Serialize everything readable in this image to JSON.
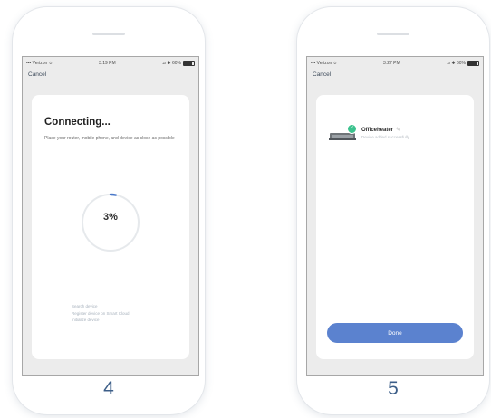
{
  "screens": [
    {
      "status": {
        "carrier": "••• Verizon ≎",
        "time": "3:19 PM",
        "battery": "⊿ ✱ 60%"
      },
      "cancel_label": "Cancel",
      "title": "Connecting...",
      "description": "Place your router, mobile phone, and device as close as possible",
      "progress": {
        "percent": 3,
        "label": "3%"
      },
      "steps": [
        "Search device",
        "Register device on Smart Cloud",
        "Initialize device"
      ],
      "step_number": "4"
    },
    {
      "status": {
        "carrier": "••• Verizon ≎",
        "time": "3:27 PM",
        "battery": "⊿ ✱ 60%"
      },
      "cancel_label": "Cancel",
      "device": {
        "name": "Officeheater",
        "subtitle": "Device added successfully"
      },
      "done_label": "Done",
      "step_number": "5"
    }
  ],
  "colors": {
    "accent": "#5b82cf",
    "progress_track": "#e6e9ec",
    "progress_arc": "#4a78c9",
    "success": "#3cc28e",
    "step_number": "#3c5e88"
  },
  "icons": [
    "signal-icon",
    "wifi-icon",
    "battery-icon",
    "check-icon",
    "edit-icon",
    "heater-device-icon"
  ]
}
